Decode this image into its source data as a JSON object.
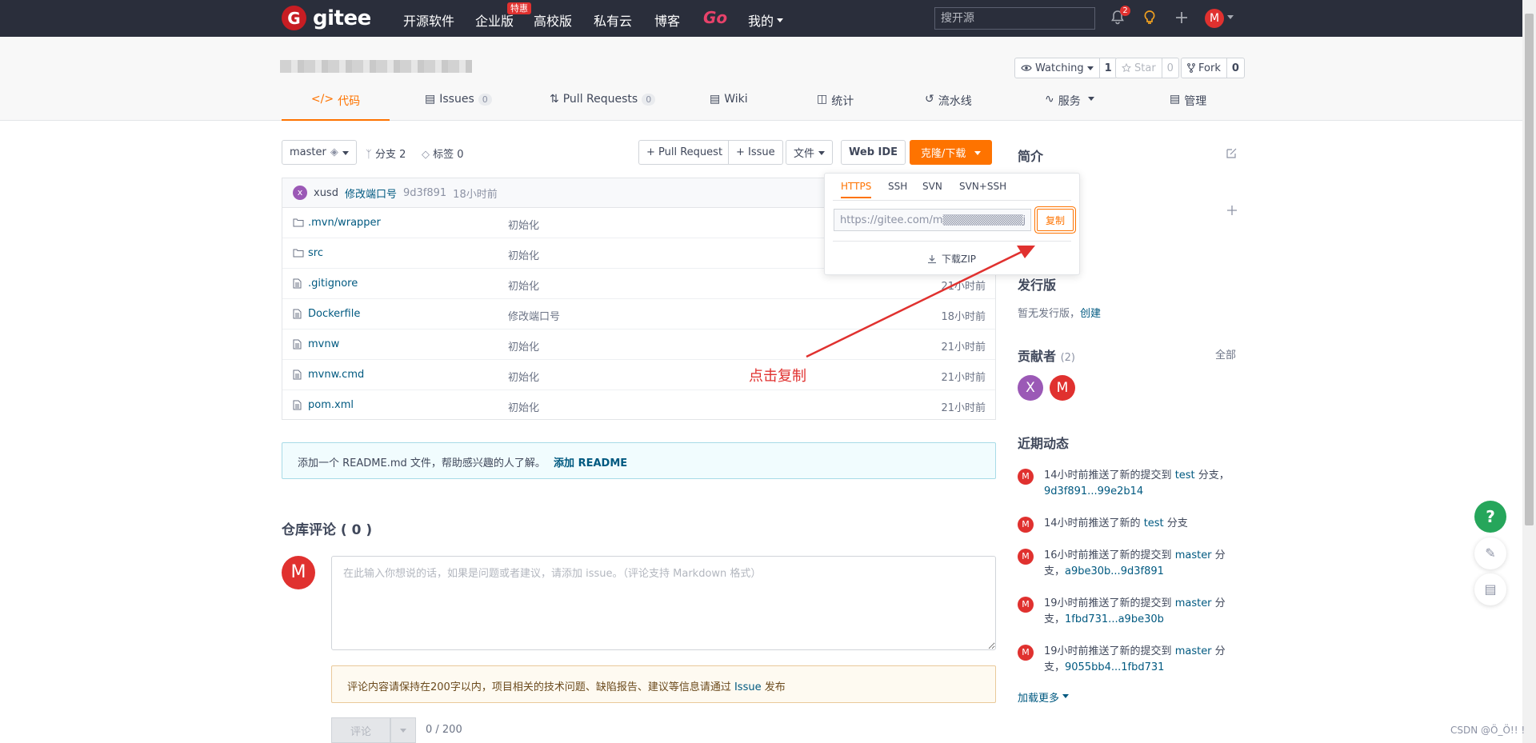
{
  "nav": {
    "logo_text": "gitee",
    "items": [
      "开源软件",
      "企业版",
      "高校版",
      "私有云",
      "博客",
      "Go",
      "我的"
    ],
    "hot_badge": "特惠",
    "search_placeholder": "搜开源",
    "notif_count": "2",
    "avatar": "M"
  },
  "repo": {
    "watch_label": "Watching",
    "watch_count": "1",
    "star_label": "Star",
    "star_count": "0",
    "fork_label": "Fork",
    "fork_count": "0"
  },
  "tabs": [
    {
      "label": "代码"
    },
    {
      "label": "Issues",
      "count": "0"
    },
    {
      "label": "Pull Requests",
      "count": "0"
    },
    {
      "label": "Wiki"
    },
    {
      "label": "统计"
    },
    {
      "label": "流水线"
    },
    {
      "label": "服务"
    },
    {
      "label": "管理"
    }
  ],
  "toolbar": {
    "branch": "master",
    "branches": "分支 2",
    "tags": "标签 0",
    "pull_request": "+ Pull Request",
    "issue": "+ Issue",
    "file": "文件",
    "web_ide": "Web IDE",
    "clone": "克隆/下载"
  },
  "commit": {
    "avatar": "x",
    "author": "xusd",
    "message": "修改端口号",
    "hash": "9d3f891",
    "time": "18小时前"
  },
  "files": [
    {
      "name": ".mvn/wrapper",
      "msg": "初始化",
      "time": "",
      "type": "folder"
    },
    {
      "name": "src",
      "msg": "初始化",
      "time": "",
      "type": "folder"
    },
    {
      "name": ".gitignore",
      "msg": "初始化",
      "time": "21小时前",
      "type": "file"
    },
    {
      "name": "Dockerfile",
      "msg": "修改端口号",
      "time": "18小时前",
      "type": "file"
    },
    {
      "name": "mvnw",
      "msg": "初始化",
      "time": "21小时前",
      "type": "file"
    },
    {
      "name": "mvnw.cmd",
      "msg": "初始化",
      "time": "21小时前",
      "type": "file"
    },
    {
      "name": "pom.xml",
      "msg": "初始化",
      "time": "21小时前",
      "type": "file"
    }
  ],
  "readme_tip": {
    "text": "添加一个 README.md 文件，帮助感兴趣的人了解。",
    "link": "添加 README"
  },
  "comments": {
    "title": "仓库评论 ( 0 )",
    "avatar": "M",
    "placeholder": "在此输入你想说的话，如果是问题或者建议，请添加 issue。（评论支持 Markdown 格式）",
    "warn_text": "评论内容请保持在200字以内，项目相关的技术问题、缺陷报告、建议等信息请通过",
    "warn_link": "Issue",
    "warn_suffix": "发布",
    "submit": "评论",
    "char_count": "0 / 200"
  },
  "clone_popover": {
    "tabs": [
      "HTTPS",
      "SSH",
      "SVN",
      "SVN+SSH"
    ],
    "url": "https://gitee.com/m▒▒▒▒▒▒▒▒▒▒jenkins",
    "copy": "复制",
    "zip": "下载ZIP"
  },
  "sidebar": {
    "intro": "简介",
    "release_title": "发行版",
    "release_text": "暂无发行版，",
    "release_link": "创建",
    "contrib_title": "贡献者",
    "contrib_count": "(2)",
    "contrib_all": "全部",
    "contributors": [
      {
        "initial": "X",
        "color": "#9b59b6"
      },
      {
        "initial": "M",
        "color": "#e0312f"
      }
    ],
    "activity_title": "近期动态",
    "activities": [
      {
        "text": "14小时前推送了新的提交到 ",
        "link": "test",
        "rest": " 分支，",
        "link2": "9d3f891...99e2b14"
      },
      {
        "text": "14小时前推送了新的 ",
        "link": "test",
        "rest": " 分支",
        "link2": ""
      },
      {
        "text": "16小时前推送了新的提交到 ",
        "link": "master",
        "rest": " 分支，",
        "link2": "a9be30b...9d3f891"
      },
      {
        "text": "19小时前推送了新的提交到 ",
        "link": "master",
        "rest": " 分支，",
        "link2": "1fbd731...a9be30b"
      },
      {
        "text": "19小时前推送了新的提交到 ",
        "link": "master",
        "rest": " 分支，",
        "link2": "9055bb4...1fbd731"
      }
    ],
    "load_more": "加载更多"
  },
  "annotation": "点击复制",
  "watermark": "CSDN @Ö_Ö!! !",
  "colors": {
    "accent": "#fe7300",
    "nav_bg": "#2a2e3b",
    "link": "#005980",
    "red": "#e0312f"
  }
}
